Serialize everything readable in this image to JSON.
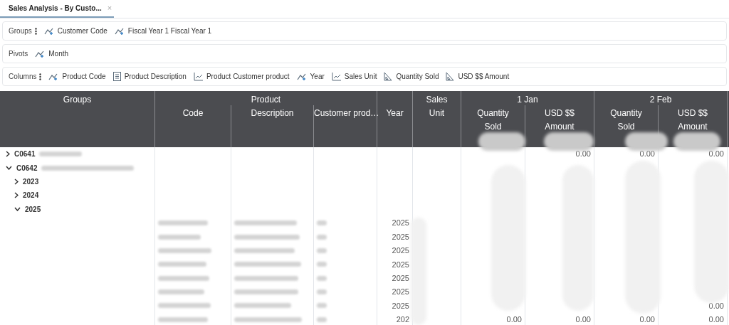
{
  "tab": {
    "title": "Sales Analysis - By Custo...",
    "close": "×",
    "selected": true
  },
  "toolbars": [
    {
      "label": "Groups",
      "menu": true,
      "chips": [
        {
          "kind": "dimension",
          "label": "Customer Code"
        },
        {
          "kind": "dimension",
          "label": "Fiscal Year 1 Fiscal Year 1"
        }
      ]
    },
    {
      "label": "Pivots",
      "menu": false,
      "chips": [
        {
          "kind": "dimension",
          "label": "Month"
        }
      ]
    },
    {
      "label": "Columns",
      "menu": true,
      "chips": [
        {
          "kind": "dimension",
          "label": "Product Code"
        },
        {
          "kind": "text",
          "label": "Product Description"
        },
        {
          "kind": "line",
          "label": "Product Customer product"
        },
        {
          "kind": "dimension",
          "label": "Year"
        },
        {
          "kind": "line",
          "label": "Sales Unit"
        },
        {
          "kind": "measure",
          "label": "Quantity Sold"
        },
        {
          "kind": "measure",
          "label": "USD $$ Amount"
        }
      ]
    }
  ],
  "table": {
    "header": {
      "groups": "Groups",
      "product": "Product",
      "product_columns": [
        "Code",
        "Description",
        "Customer prod…"
      ],
      "year": "Year",
      "sales_unit": "Sales Unit",
      "months": [
        {
          "label": "1 Jan",
          "columns": [
            "Quantity Sold",
            "USD $$ Amount"
          ]
        },
        {
          "label": "2 Feb",
          "columns": [
            "Quantity Sold",
            "USD $$ Amount"
          ]
        }
      ]
    },
    "tree": [
      {
        "label": "C0641",
        "expanded": false,
        "values": {
          "jan_amount": "0.00",
          "feb_quantity": "0.00",
          "feb_amount": "0.00"
        }
      },
      {
        "label": "C0642",
        "expanded": true,
        "children": [
          {
            "label": "2023",
            "expanded": false
          },
          {
            "label": "2024",
            "expanded": false
          },
          {
            "label": "2025",
            "expanded": true,
            "rows": [
              {
                "year": "2025"
              },
              {
                "year": "2025"
              },
              {
                "year": "2025"
              },
              {
                "year": "2025"
              },
              {
                "year": "2025"
              },
              {
                "year": "2025"
              },
              {
                "year": "2025",
                "values": {
                  "feb_amount": "0.00"
                }
              },
              {
                "year": "202",
                "values": {
                  "jan_quantity": "0.00",
                  "jan_amount": "0.00",
                  "feb_quantity": "0.00",
                  "feb_amount": "0.00"
                }
              }
            ]
          }
        ]
      }
    ]
  }
}
